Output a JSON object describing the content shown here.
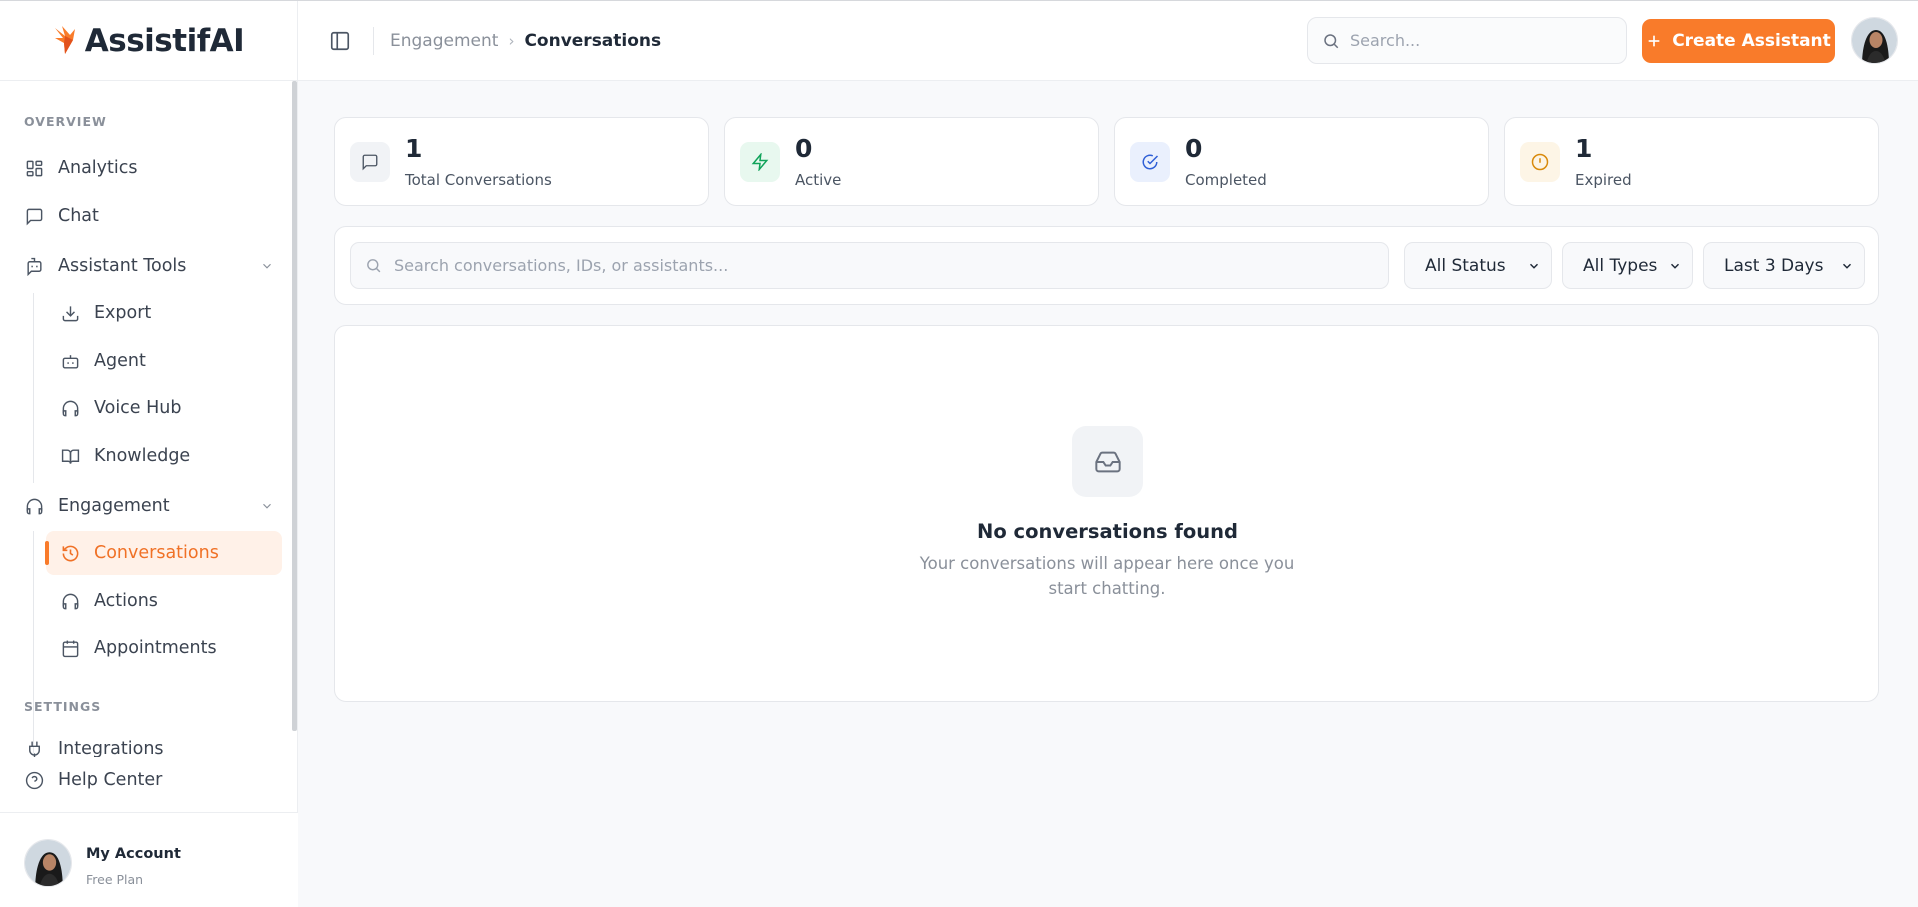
{
  "app": {
    "brand": "AssistifAI",
    "brand_color": "#f97b2a"
  },
  "header": {
    "breadcrumb": {
      "parent": "Engagement",
      "separator": "›",
      "current": "Conversations"
    },
    "search": {
      "placeholder": "Search..."
    },
    "create_button": {
      "label": "Create Assistant",
      "icon": "plus-icon"
    }
  },
  "sidebar": {
    "overview_label": "OVERVIEW",
    "settings_label": "SETTINGS",
    "items": {
      "analytics": {
        "label": "Analytics",
        "icon": "grid-icon"
      },
      "chat": {
        "label": "Chat",
        "icon": "message-icon"
      },
      "assistant_tools": {
        "label": "Assistant Tools",
        "icon": "bot-message-icon",
        "expanded": true
      },
      "export": {
        "label": "Export",
        "icon": "download-icon"
      },
      "agent": {
        "label": "Agent",
        "icon": "bot-icon"
      },
      "voice_hub": {
        "label": "Voice Hub",
        "icon": "headphones-icon"
      },
      "knowledge": {
        "label": "Knowledge",
        "icon": "book-icon"
      },
      "engagement": {
        "label": "Engagement",
        "icon": "headphones-icon",
        "expanded": true
      },
      "conversations": {
        "label": "Conversations",
        "icon": "history-icon",
        "active": true
      },
      "actions": {
        "label": "Actions",
        "icon": "headphones-icon"
      },
      "appointments": {
        "label": "Appointments",
        "icon": "calendar-icon"
      },
      "integrations": {
        "label": "Integrations",
        "icon": "plug-icon"
      },
      "help_center": {
        "label": "Help Center",
        "icon": "help-circle-icon"
      }
    },
    "account": {
      "name": "My Account",
      "plan": "Free Plan"
    }
  },
  "stats": [
    {
      "value": "1",
      "label": "Total Conversations",
      "icon": "message-square-icon",
      "color": "#4b5563",
      "bg": "#f1f3f6"
    },
    {
      "value": "0",
      "label": "Active",
      "icon": "zap-icon",
      "color": "#10a35a",
      "bg": "#e8f8ef"
    },
    {
      "value": "0",
      "label": "Completed",
      "icon": "check-circle-icon",
      "color": "#2f5fd6",
      "bg": "#eaf0fd"
    },
    {
      "value": "1",
      "label": "Expired",
      "icon": "alert-circle-icon",
      "color": "#d98a0b",
      "bg": "#fdf5e6"
    }
  ],
  "filters": {
    "search_placeholder": "Search conversations, IDs, or assistants...",
    "status": "All Status",
    "type": "All Types",
    "range": "Last 3 Days"
  },
  "empty_state": {
    "icon": "inbox-icon",
    "title": "No conversations found",
    "description": "Your conversations will appear here once you start chatting."
  }
}
